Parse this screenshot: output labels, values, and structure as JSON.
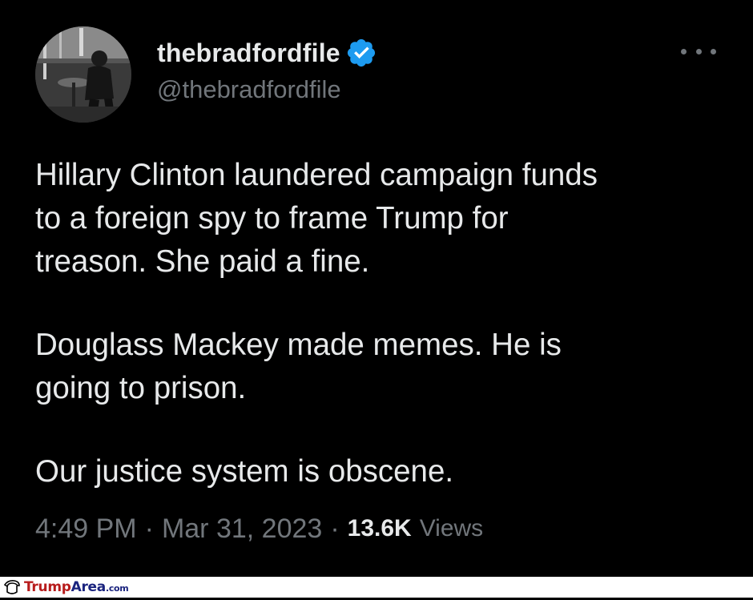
{
  "author": {
    "display_name": "thebradfordfile",
    "handle": "@thebradfordfile",
    "verified_icon": "verified-badge-icon",
    "badge_color": "#1d9bf0"
  },
  "tweet": {
    "paragraphs": [
      "Hillary Clinton laundered campaign funds\nto a foreign spy to frame Trump for\ntreason. She paid a fine.",
      "Douglass Mackey made memes. He is\ngoing to prison.",
      "Our justice system is obscene."
    ],
    "time": "4:49 PM",
    "date": "Mar 31, 2023",
    "separator": "·",
    "views_count": "13.6K",
    "views_label": "Views"
  },
  "menu": {
    "icon": "more-options-icon"
  },
  "watermark": {
    "icon": "trump-hair-logo-icon",
    "part1": "Trump",
    "part2": "Area",
    "part3": ".com"
  },
  "colors": {
    "background": "#000000",
    "text_primary": "#e7e9ea",
    "text_secondary": "#71767b"
  }
}
